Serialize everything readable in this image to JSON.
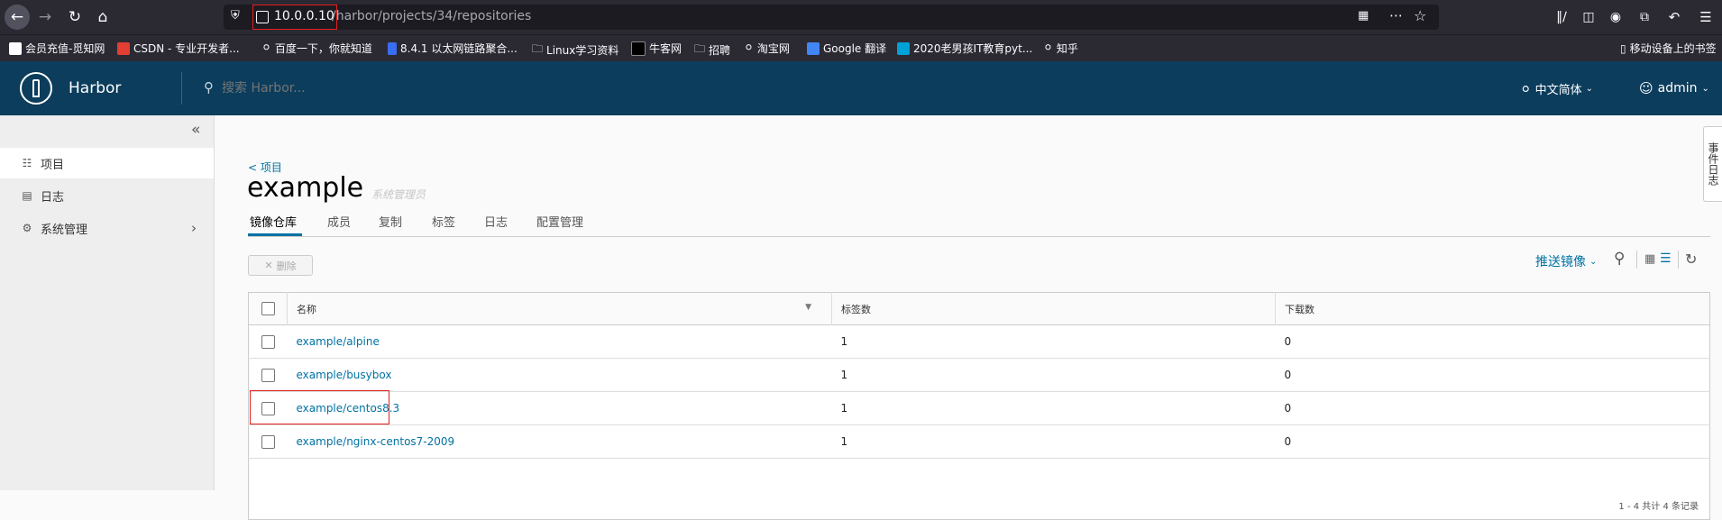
{
  "browser": {
    "url_host": "10.0.0.10",
    "url_path": "/harbor/projects/34/repositories",
    "bookmarks": [
      {
        "label": "会员充值-觅知网",
        "icon": "mi-icon",
        "color": "#ffffff"
      },
      {
        "label": "CSDN - 专业开发者...",
        "icon": "csdn-icon",
        "color": "#e33e33"
      },
      {
        "label": "百度一下，你就知道",
        "icon": "globe-icon",
        "color": ""
      },
      {
        "label": "8.4.1 以太网链路聚合...",
        "icon": "bookmark-icon",
        "color": "#3a6df0"
      },
      {
        "label": "Linux学习资料",
        "icon": "folder-icon",
        "color": ""
      },
      {
        "label": "牛客网",
        "icon": "nowcoder-icon",
        "color": "#000000"
      },
      {
        "label": "招聘",
        "icon": "folder-icon",
        "color": ""
      },
      {
        "label": "淘宝网",
        "icon": "globe-icon",
        "color": ""
      },
      {
        "label": "Google 翻译",
        "icon": "google-translate-icon",
        "color": "#4285f4"
      },
      {
        "label": "2020老男孩IT教育pyt...",
        "icon": "bilibili-icon",
        "color": "#00a1d6"
      },
      {
        "label": "知乎",
        "icon": "globe-icon",
        "color": ""
      }
    ],
    "mobile_bookmarks": "移动设备上的书签"
  },
  "header": {
    "brand": "Harbor",
    "search_placeholder": "搜索 Harbor...",
    "language": "中文简体",
    "user": "admin"
  },
  "sidebar": {
    "items": [
      {
        "label": "项目",
        "icon": "projects-icon",
        "active": true
      },
      {
        "label": "日志",
        "icon": "logs-icon",
        "active": false
      },
      {
        "label": "系统管理",
        "icon": "admin-icon",
        "active": false
      }
    ]
  },
  "page": {
    "back_link": "< 项目",
    "title": "example",
    "role": "系统管理员",
    "tabs": [
      "镜像仓库",
      "成员",
      "复制",
      "标签",
      "日志",
      "配置管理"
    ],
    "delete_button": "删除",
    "push_image": "推送镜像",
    "side_tab": "事件日志"
  },
  "table": {
    "columns": [
      "名称",
      "标签数",
      "下载数"
    ],
    "rows": [
      {
        "name": "example/alpine",
        "tags": "1",
        "pulls": "0"
      },
      {
        "name": "example/busybox",
        "tags": "1",
        "pulls": "0"
      },
      {
        "name": "example/centos8.3",
        "tags": "1",
        "pulls": "0"
      },
      {
        "name": "example/nginx-centos7-2009",
        "tags": "1",
        "pulls": "0"
      }
    ],
    "footer": "1 - 4 共计 4 条记录"
  },
  "colors": {
    "header_bg": "#0c3d5c",
    "link": "#0072a3",
    "highlight_box": "#e02020"
  }
}
